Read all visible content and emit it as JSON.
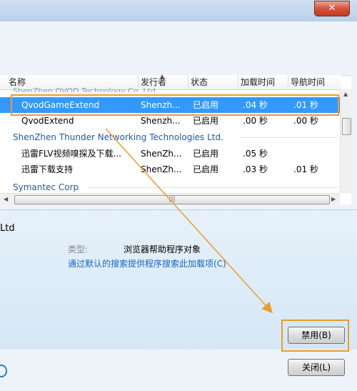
{
  "window": {
    "close_label": "✕"
  },
  "columns": [
    "名称",
    "发行者",
    "状态",
    "加载时间",
    "导航时间"
  ],
  "groups": {
    "qvod_partial": "ShenZhen QVOD Technology Co.,Ltd",
    "thunder": "ShenZhen Thunder Networking Technologies Ltd.",
    "symantec": "Symantec Corp"
  },
  "rows": [
    {
      "name": "QvodGameExtend",
      "publisher": "Shenzh...",
      "status": "已启用",
      "load": ".04 秒",
      "nav": ".01 秒"
    },
    {
      "name": "QvodExtend",
      "publisher": "Shenzh...",
      "status": "已启用",
      "load": ".00 秒",
      "nav": ".00 秒"
    },
    {
      "name": "迅雷FLV视频嗅探及下载...",
      "publisher": "ShenZh...",
      "status": "已启用",
      "load": ".05 秒",
      "nav": ""
    },
    {
      "name": "迅雷下载支持",
      "publisher": "ShenZh...",
      "status": "已启用",
      "load": ".03 秒",
      "nav": ".01 秒"
    }
  ],
  "scroll": {
    "h_thumb_grip": "|||"
  },
  "details": {
    "title_partial": "Ltd",
    "type_label": "类型:",
    "type_value": "浏览器帮助程序对象",
    "search_link": "通过默认的搜索提供程序搜索此加载项(C)"
  },
  "buttons": {
    "disable": "禁用(B)",
    "close": "关闭(L)"
  },
  "colors": {
    "selection": "#3399ff",
    "highlight": "#f09a2a",
    "link": "#1a64c8"
  }
}
